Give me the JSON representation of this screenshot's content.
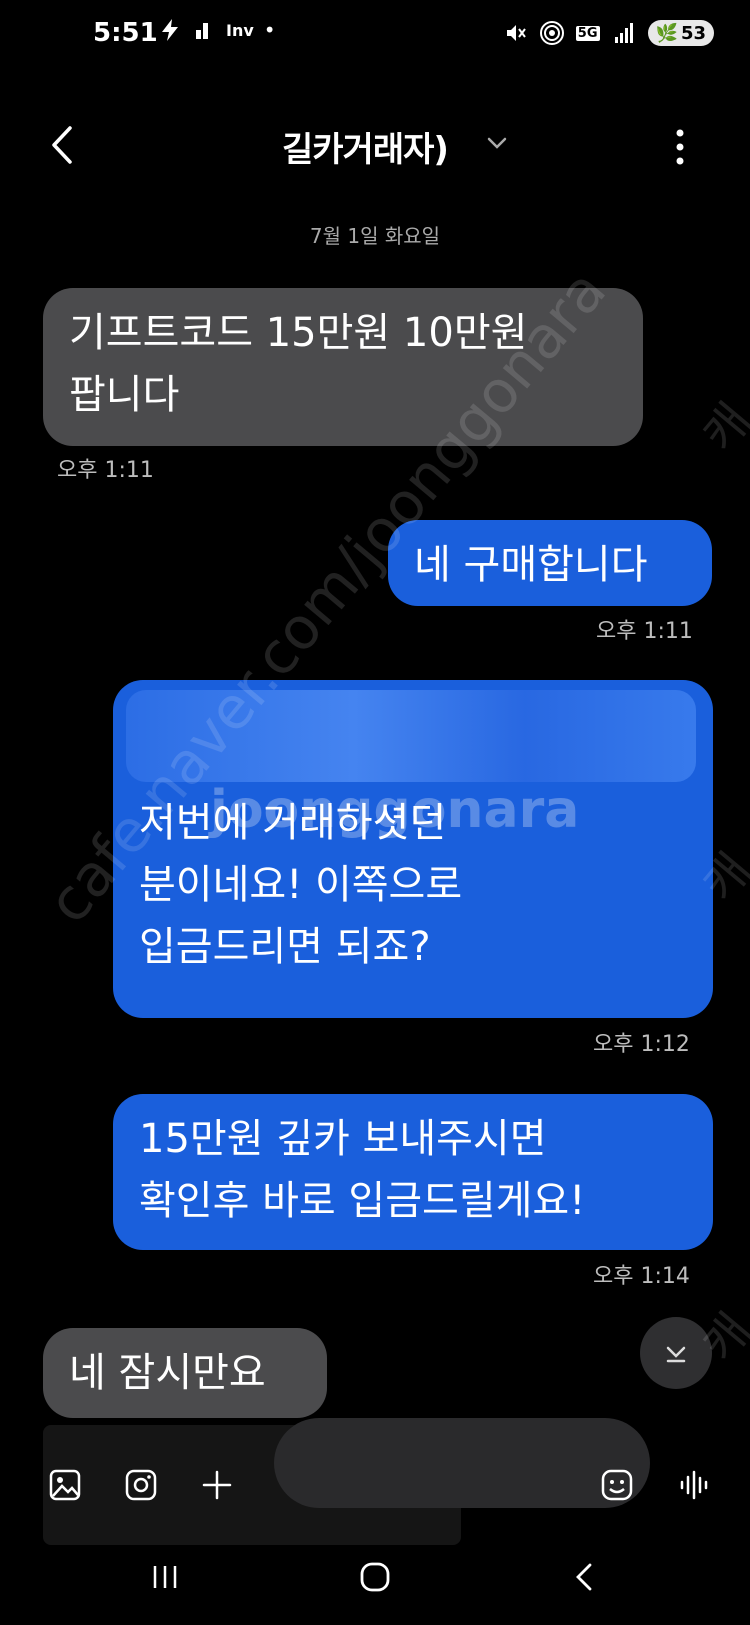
{
  "status_bar": {
    "time": "5:51",
    "carrier_text": "Inv",
    "battery": "53",
    "network": "5G"
  },
  "header": {
    "title": "길카거래자)"
  },
  "conversation": {
    "date_separator": "7월 1일 화요일",
    "messages": [
      {
        "from": "received",
        "text": "기프트코드 15만원 10만원\n팝니다",
        "time": "오후 1:11"
      },
      {
        "from": "sent",
        "text": "네 구매합니다",
        "time": "오후 1:11"
      },
      {
        "from": "sent",
        "text": "저번에 거래하셧던\n분이네요! 이쪽으로\n입금드리면 되죠?",
        "time": "오후 1:12"
      },
      {
        "from": "sent",
        "text": "15만원 깊카 보내주시면\n확인후 바로 입금드릴게요!",
        "time": "오후 1:14"
      },
      {
        "from": "received",
        "text": "네 잠시만요",
        "time": ""
      }
    ]
  },
  "watermark": {
    "diagonal": "cafe.naver.com/joonggonara",
    "center": "joonggonara",
    "side": "캐"
  },
  "colors": {
    "background": "#000000",
    "received_bubble": "#4b4b4d",
    "sent_bubble": "#1a5fdc"
  }
}
